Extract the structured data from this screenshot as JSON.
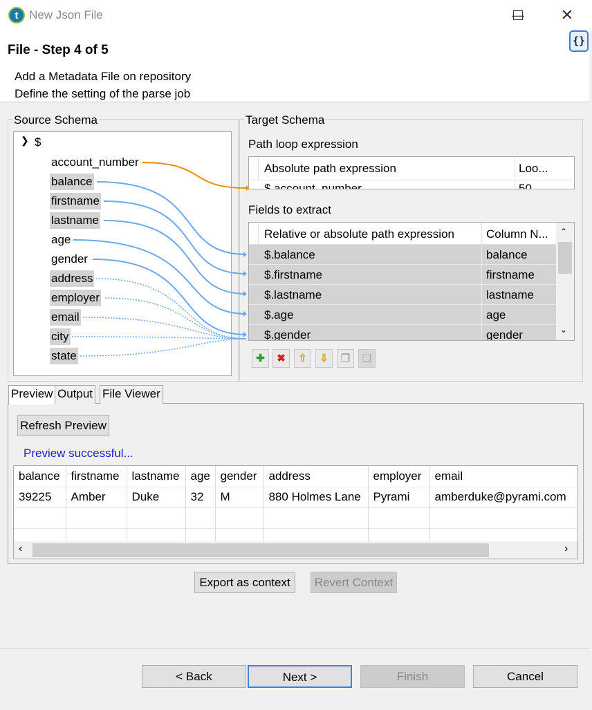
{
  "window": {
    "title": "New Json File",
    "app_icon": "talend-icon",
    "controls": [
      "minimize-icon",
      "maximize-icon",
      "close-icon"
    ]
  },
  "header": {
    "step_title": "File - Step 4 of 5",
    "desc_line1": "Add a Metadata File on repository",
    "desc_line2": "Define the setting of the parse job",
    "badge": "{}"
  },
  "source": {
    "label": "Source Schema",
    "root": "$",
    "nodes": [
      "account_number",
      "balance",
      "firstname",
      "lastname",
      "age",
      "gender",
      "address",
      "employer",
      "email",
      "city",
      "state"
    ]
  },
  "target": {
    "label": "Target Schema",
    "loop_label": "Path loop expression",
    "loop_header": [
      "Absolute path expression",
      "Loo..."
    ],
    "loop_row": [
      "$.account_number",
      "50"
    ],
    "fields_label": "Fields to extract",
    "fields_header": [
      "Relative or absolute path expression",
      "Column N..."
    ],
    "fields_rows": [
      [
        "$.balance",
        "balance"
      ],
      [
        "$.firstname",
        "firstname"
      ],
      [
        "$.lastname",
        "lastname"
      ],
      [
        "$.age",
        "age"
      ],
      [
        "$.gender",
        "gender"
      ]
    ],
    "toolbar_icons": [
      "add-icon",
      "delete-icon",
      "move-up-icon",
      "move-down-icon",
      "copy-icon",
      "paste-icon"
    ]
  },
  "tabs": [
    "Preview",
    "Output",
    "File Viewer"
  ],
  "preview": {
    "refresh_label": "Refresh Preview",
    "status": "Preview successful...",
    "status_color": "#1a1adb",
    "columns": [
      "balance",
      "firstname",
      "lastname",
      "age",
      "gender",
      "address",
      "employer",
      "email"
    ],
    "rows": [
      [
        "39225",
        "Amber",
        "Duke",
        "32",
        "M",
        "880 Holmes Lane",
        "Pyrami",
        "amberduke@pyrami.com"
      ]
    ]
  },
  "context_buttons": {
    "export": "Export as context",
    "revert": "Revert Context"
  },
  "footer": {
    "back": "< Back",
    "next": "Next >",
    "finish": "Finish",
    "cancel": "Cancel"
  },
  "colors": {
    "link_solid": "#6aa8f0",
    "link_loop": "#f08a00",
    "selection": "#d3d3d3"
  }
}
